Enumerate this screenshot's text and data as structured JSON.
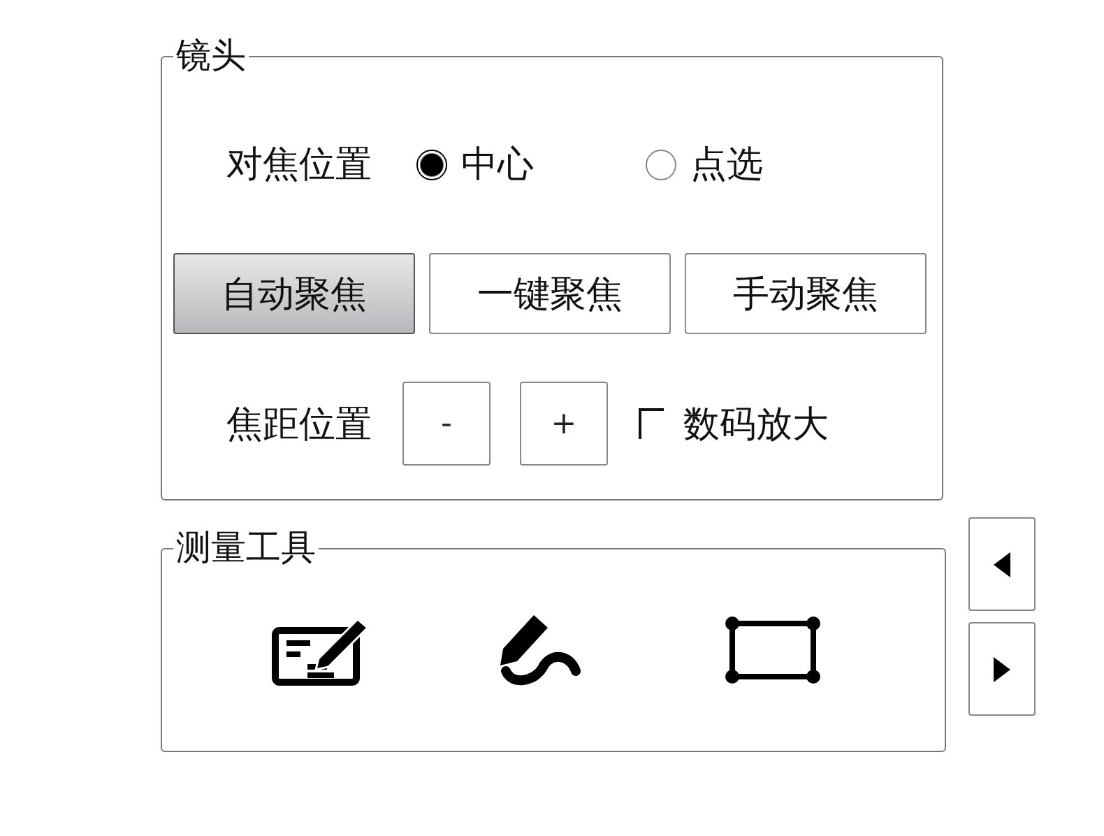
{
  "lens": {
    "title": "镜头",
    "focus_position": {
      "label": "对焦位置",
      "options": [
        {
          "label": "中心",
          "selected": true
        },
        {
          "label": "点选",
          "selected": false
        }
      ]
    },
    "focus_modes": [
      {
        "label": "自动聚焦",
        "selected": true
      },
      {
        "label": "一键聚焦",
        "selected": false
      },
      {
        "label": "手动聚焦",
        "selected": false
      }
    ],
    "zoom": {
      "label": "焦距位置",
      "buttons": [
        "-",
        "+"
      ],
      "digital_zoom": {
        "label": "数码放大",
        "checked": false
      }
    }
  },
  "measure_tools": {
    "title": "测量工具",
    "tools": [
      {
        "kind": "annotate"
      },
      {
        "kind": "freehand"
      },
      {
        "kind": "rectangle"
      }
    ]
  },
  "nav_buttons": [
    {
      "kind": "left"
    },
    {
      "kind": "right"
    }
  ]
}
